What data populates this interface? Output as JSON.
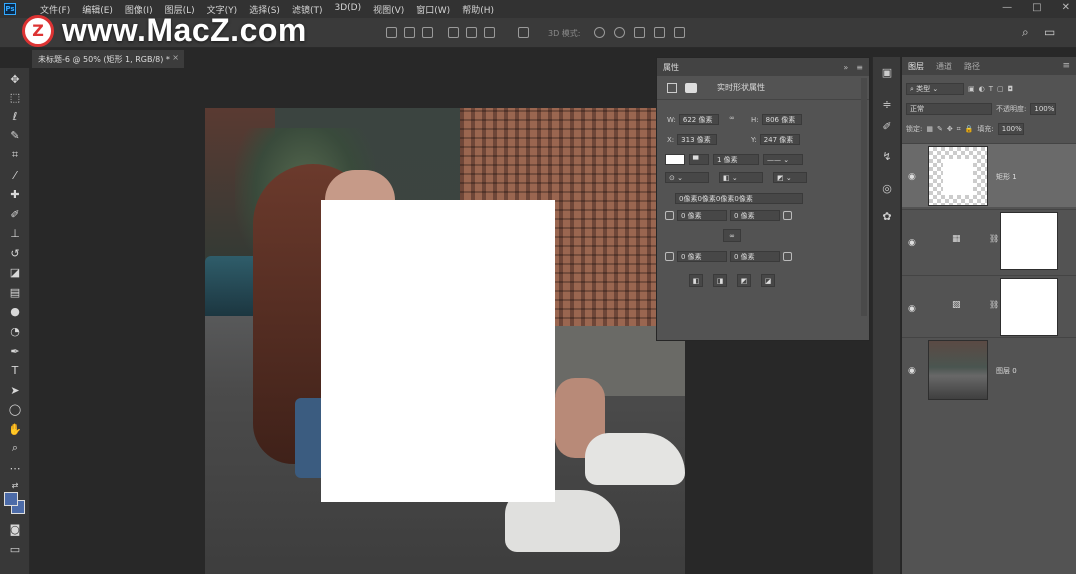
{
  "watermark": {
    "logo_letter": "Z",
    "text": "www.MacZ.com"
  },
  "menubar": {
    "logo": "Ps",
    "items": [
      "文件(F)",
      "编辑(E)",
      "图像(I)",
      "图层(L)",
      "文字(Y)",
      "选择(S)",
      "滤镜(T)",
      "3D(D)",
      "视图(V)",
      "窗口(W)",
      "帮助(H)"
    ]
  },
  "optbar": {
    "mode_3d": "3D 模式:"
  },
  "document": {
    "tab_title": "未标题-6 @ 50% (矩形 1, RGB/8) *"
  },
  "properties": {
    "tab": "属性",
    "section_label": "实时形状属性",
    "w_label": "W:",
    "w_value": "622 像素",
    "h_label": "H:",
    "h_value": "806 像素",
    "x_label": "X:",
    "x_value": "313 像素",
    "y_label": "Y:",
    "y_value": "247 像素",
    "stroke_width": "1 像素",
    "corner_radii": "0像素0像素0像素0像素",
    "corner_tl": "0 像素",
    "corner_tr": "0 像素",
    "corner_bl": "0 像素",
    "corner_br": "0 像素"
  },
  "layers_panel": {
    "tabs": [
      "图层",
      "通道",
      "路径"
    ],
    "filter_kind": "类型",
    "blend_mode": "正常",
    "opacity_label": "不透明度:",
    "opacity_value": "100%",
    "lock_label": "锁定:",
    "fill_label": "填充:",
    "fill_value": "100%",
    "layers": [
      {
        "name": "矩形 1"
      },
      {
        "name": ""
      },
      {
        "name": ""
      },
      {
        "name": "图层 0"
      }
    ]
  }
}
